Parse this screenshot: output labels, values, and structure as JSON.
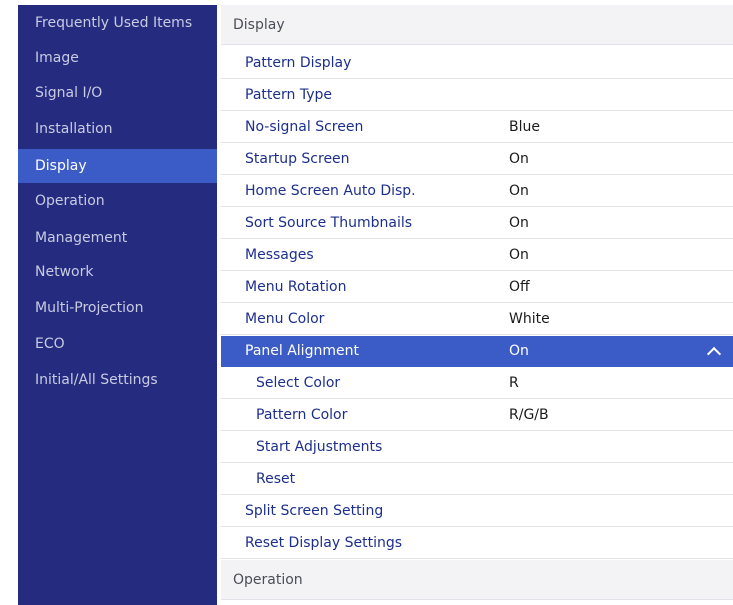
{
  "sidebar": {
    "items": [
      {
        "label": "Frequently Used Items"
      },
      {
        "label": "Image"
      },
      {
        "label": "Signal I/O"
      },
      {
        "label": "Installation"
      },
      {
        "label": "Display",
        "active": true
      },
      {
        "label": "Operation"
      },
      {
        "label": "Management"
      },
      {
        "label": "Network"
      },
      {
        "label": "Multi-Projection"
      },
      {
        "label": "ECO"
      },
      {
        "label": "Initial/All Settings"
      }
    ]
  },
  "content": {
    "section_header": "Display",
    "rows": [
      {
        "label": "Pattern Display",
        "value": ""
      },
      {
        "label": "Pattern Type",
        "value": ""
      },
      {
        "label": "No-signal Screen",
        "value": "Blue"
      },
      {
        "label": "Startup Screen",
        "value": "On"
      },
      {
        "label": "Home Screen Auto Disp.",
        "value": "On"
      },
      {
        "label": "Sort Source Thumbnails",
        "value": "On"
      },
      {
        "label": "Messages",
        "value": "On"
      },
      {
        "label": "Menu Rotation",
        "value": "Off"
      },
      {
        "label": "Menu Color",
        "value": "White"
      },
      {
        "label": "Panel Alignment",
        "value": "On"
      },
      {
        "label": "Select Color",
        "value": "R"
      },
      {
        "label": "Pattern Color",
        "value": "R/G/B"
      },
      {
        "label": "Start Adjustments",
        "value": ""
      },
      {
        "label": "Reset",
        "value": ""
      },
      {
        "label": "Split Screen Setting",
        "value": ""
      },
      {
        "label": "Reset Display Settings",
        "value": ""
      }
    ],
    "next_section_header": "Operation"
  },
  "colors": {
    "sidebar_bg": "#252b7e",
    "active_bg": "#3b5cc7",
    "item_text": "#1d2f8c"
  }
}
